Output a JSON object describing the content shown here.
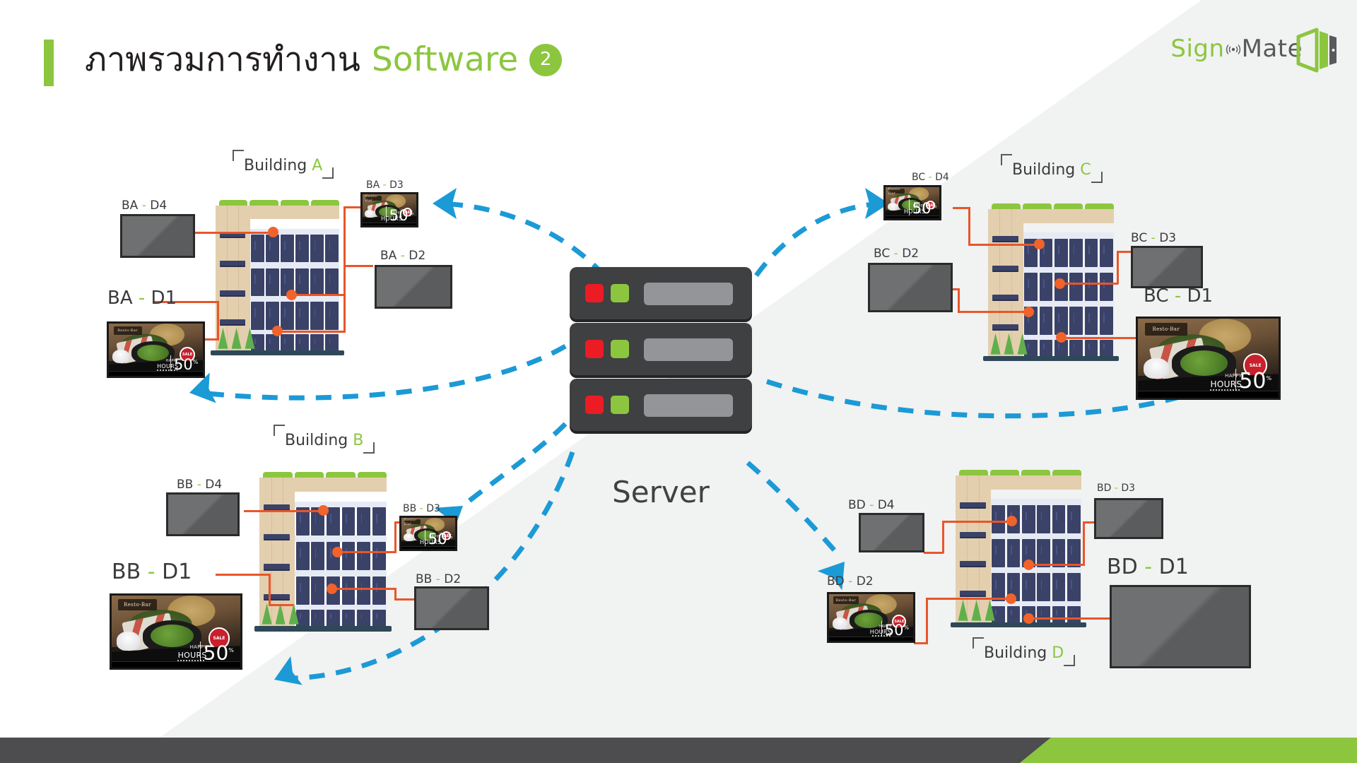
{
  "header": {
    "title_thai": "ภาพรวมการทำงาน",
    "title_en": "Software",
    "badge": "2",
    "accent_color": "#8cc63f"
  },
  "logo": {
    "part1": "Sign",
    "part2": "Mate",
    "wifi_icon": "wifi-icon",
    "screen_icon": "tablet-screen-icon",
    "color_part1": "#8cc63f",
    "color_part2": "#58595b"
  },
  "server": {
    "label": "Server",
    "rack_count": 3,
    "led_red_color": "#ec1c24",
    "led_green_color": "#8cc63f",
    "chassis_color": "#3f4042"
  },
  "ad_creative": {
    "brand": "Resto-Bar",
    "headline": "HAPPY",
    "headline2": "HOURS",
    "discount": "50",
    "discount_unit": "%",
    "badge": "SALE"
  },
  "buildings": [
    {
      "id": "A",
      "label_prefix": "Building",
      "label_id": "A",
      "displays": [
        {
          "name": "BA",
          "dash": "-",
          "num": "D4",
          "state": "off"
        },
        {
          "name": "BA",
          "dash": "-",
          "num": "D3",
          "state": "on"
        },
        {
          "name": "BA",
          "dash": "-",
          "num": "D2",
          "state": "off"
        },
        {
          "name": "BA",
          "dash": "-",
          "num": "D1",
          "state": "on"
        }
      ]
    },
    {
      "id": "B",
      "label_prefix": "Building",
      "label_id": "B",
      "displays": [
        {
          "name": "BB",
          "dash": "-",
          "num": "D4",
          "state": "off"
        },
        {
          "name": "BB",
          "dash": "-",
          "num": "D3",
          "state": "on"
        },
        {
          "name": "BB",
          "dash": "-",
          "num": "D2",
          "state": "off"
        },
        {
          "name": "BB",
          "dash": "-",
          "num": "D1",
          "state": "on"
        }
      ]
    },
    {
      "id": "C",
      "label_prefix": "Building",
      "label_id": "C",
      "displays": [
        {
          "name": "BC",
          "dash": "-",
          "num": "D4",
          "state": "on"
        },
        {
          "name": "BC",
          "dash": "-",
          "num": "D3",
          "state": "off"
        },
        {
          "name": "BC",
          "dash": "-",
          "num": "D2",
          "state": "off"
        },
        {
          "name": "BC",
          "dash": "-",
          "num": "D1",
          "state": "on"
        }
      ]
    },
    {
      "id": "D",
      "label_prefix": "Building",
      "label_id": "D",
      "displays": [
        {
          "name": "BD",
          "dash": "-",
          "num": "D4",
          "state": "off"
        },
        {
          "name": "BD",
          "dash": "-",
          "num": "D3",
          "state": "off"
        },
        {
          "name": "BD",
          "dash": "-",
          "num": "D2",
          "state": "on"
        },
        {
          "name": "BD",
          "dash": "-",
          "num": "D1",
          "state": "off"
        }
      ]
    }
  ],
  "colors": {
    "background": "#ffffff",
    "background_diagonal": "#f1f2f2",
    "accent_green": "#8cc63f",
    "flow_blue": "#1b9ad6",
    "connector_orange": "#e8562a",
    "text_dark": "#3b3b3d",
    "footer_dark": "#4d4d4f"
  }
}
